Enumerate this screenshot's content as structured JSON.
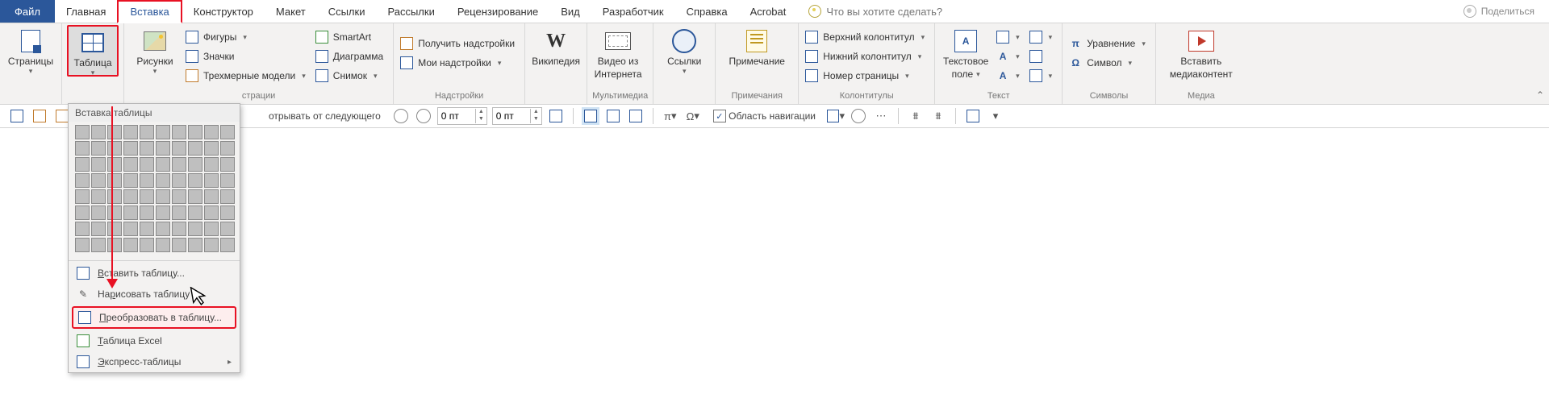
{
  "tabs": {
    "file": "Файл",
    "home": "Главная",
    "insert": "Вставка",
    "design": "Конструктор",
    "layout": "Макет",
    "references": "Ссылки",
    "mailings": "Рассылки",
    "review": "Рецензирование",
    "view": "Вид",
    "developer": "Разработчик",
    "help": "Справка",
    "acrobat": "Acrobat",
    "tell_me": "Что вы хотите сделать?",
    "share": "Поделиться"
  },
  "ribbon": {
    "pages_grp": "Страницы",
    "pages_btn": "Страницы",
    "table_btn": "Таблица",
    "pictures_btn": "Рисунки",
    "shapes": "Фигуры",
    "icons": "Значки",
    "models3d": "Трехмерные модели",
    "smartart": "SmartArt",
    "chart": "Диаграмма",
    "screenshot": "Снимок",
    "illustrations_grp": "страции",
    "get_addins": "Получить надстройки",
    "my_addins": "Мои надстройки",
    "addins_grp": "Надстройки",
    "wikipedia": "Википедия",
    "online_video_l1": "Видео из",
    "online_video_l2": "Интернета",
    "media_grp": "Мультимедиа",
    "links_btn": "Ссылки",
    "comment_btn": "Примечание",
    "comments_grp": "Примечания",
    "header": "Верхний колонтитул",
    "footer": "Нижний колонтитул",
    "page_num": "Номер страницы",
    "hf_grp": "Колонтитулы",
    "textbox_l1": "Текстовое",
    "textbox_l2": "поле",
    "text_grp": "Текст",
    "equation": "Уравнение",
    "symbol": "Символ",
    "symbols_grp": "Символы",
    "insert_media_l1": "Вставить",
    "insert_media_l2": "медиаконтент",
    "media2_grp": "Медиа"
  },
  "qat": {
    "keep_with_next": "отрывать от следующего",
    "spin1": "0 пт",
    "spin2": "0 пт",
    "nav_pane": "Область навигации",
    "pi": "π",
    "omega": "Ω"
  },
  "table_menu": {
    "header": "Вставка таблицы",
    "insert": "Вставить таблицу...",
    "draw": "Нарисовать таблицу",
    "convert": "Преобразовать в таблицу...",
    "excel": "Таблица Excel",
    "quick": "Экспресс-таблицы",
    "grid_cols": 10,
    "grid_rows": 8,
    "u_insert": "В",
    "u_draw": "р",
    "u_convert": "П",
    "u_excel": "Т",
    "u_quick": "Э"
  }
}
